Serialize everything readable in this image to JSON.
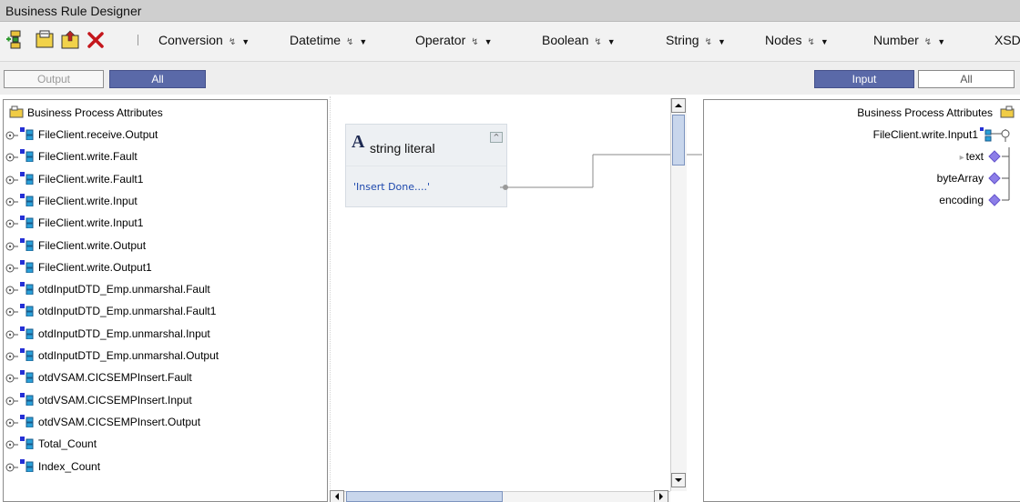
{
  "window": {
    "title": "Business Rule Designer"
  },
  "toolbar": {
    "icons": [
      "add-rule-icon",
      "save-rule-icon",
      "export-rule-icon",
      "delete-icon"
    ],
    "menus": [
      {
        "label": "Conversion"
      },
      {
        "label": "Datetime"
      },
      {
        "label": "Operator"
      },
      {
        "label": "Boolean"
      },
      {
        "label": "String"
      },
      {
        "label": "Nodes"
      },
      {
        "label": "Number"
      },
      {
        "label": "XSD"
      }
    ]
  },
  "left_tabs": {
    "output": "Output",
    "all": "All"
  },
  "right_tabs": {
    "input": "Input",
    "all": "All"
  },
  "left_tree": {
    "root": "Business Process Attributes",
    "items": [
      "FileClient.receive.Output",
      "FileClient.write.Fault",
      "FileClient.write.Fault1",
      "FileClient.write.Input",
      "FileClient.write.Input1",
      "FileClient.write.Output",
      "FileClient.write.Output1",
      "otdInputDTD_Emp.unmarshal.Fault",
      "otdInputDTD_Emp.unmarshal.Fault1",
      "otdInputDTD_Emp.unmarshal.Input",
      "otdInputDTD_Emp.unmarshal.Output",
      "otdVSAM.CICSEMPInsert.Fault",
      "otdVSAM.CICSEMPInsert.Input",
      "otdVSAM.CICSEMPInsert.Output",
      "Total_Count",
      "Index_Count"
    ]
  },
  "canvas": {
    "node": {
      "icon": "A",
      "title": "string literal",
      "value": "'Insert Done....'"
    }
  },
  "right_tree": {
    "root": "Business Process Attributes",
    "parent": "FileClient.write.Input1",
    "children": [
      "text",
      "byteArray",
      "encoding"
    ]
  },
  "colors": {
    "tab_active": "#5a69a8",
    "link_text": "#1d48ad",
    "connector_diamond": "#8c7ee8"
  }
}
